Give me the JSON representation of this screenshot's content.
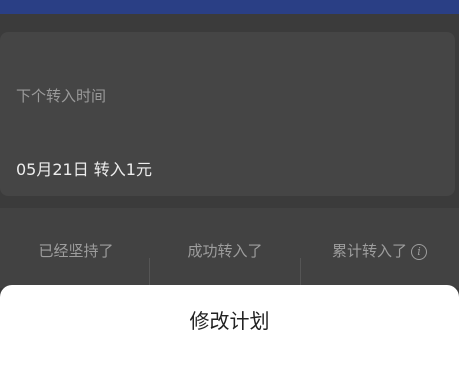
{
  "header": {
    "title": ""
  },
  "next_transfer": {
    "label": "下个转入时间",
    "value": "05月21日 转入1元"
  },
  "stats": [
    {
      "label": "已经坚持了",
      "value": ""
    },
    {
      "label": "成功转入了",
      "value": ""
    },
    {
      "label": "累计转入了",
      "value": ""
    }
  ],
  "sheet": {
    "title": "修改计划",
    "description": ""
  },
  "colors": {
    "header_bg": "#2a3f85",
    "overlay_bg": "#3b3b3b",
    "sheet_bg": "#ffffff"
  },
  "icons": {
    "info": "info-icon"
  }
}
